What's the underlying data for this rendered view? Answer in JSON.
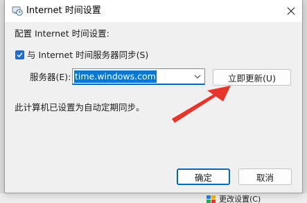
{
  "dialog": {
    "title": "Internet 时间设置",
    "group_label": "配置 Internet 时间设置:",
    "sync_checkbox": {
      "label": "与 Internet 时间服务器同步(S)",
      "checked": true
    },
    "server_label": "服务器(E):",
    "server_value": "time.windows.com",
    "update_button": "立即更新(U)",
    "status_text": "此计算机已设置为自动定期同步。",
    "ok_button": "确定",
    "cancel_button": "取消"
  },
  "background": {
    "partial_item_label": "更改设置(C)"
  },
  "icons": {
    "title": "clock-settings-icon",
    "close": "close-icon",
    "checkbox": "checkmark-icon",
    "dropdown": "chevron-down-icon",
    "annotation": "red-arrow-annotation"
  },
  "colors": {
    "accent": "#0067c0",
    "selection": "#0078d7",
    "annotation": "#e8352b"
  }
}
